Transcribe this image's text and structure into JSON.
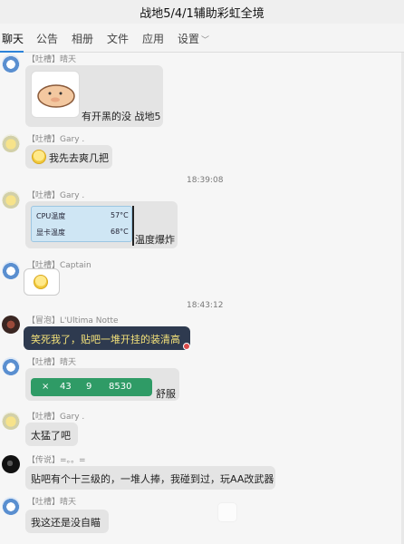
{
  "window": {
    "title": "战地5/4/1辅助彩虹全境"
  },
  "tabs": [
    {
      "label": "聊天"
    },
    {
      "label": "公告"
    },
    {
      "label": "相册"
    },
    {
      "label": "文件"
    },
    {
      "label": "应用"
    },
    {
      "label": "设置"
    }
  ],
  "messages": [
    {
      "sender": "【吐槽】晴天",
      "text": "有开黑的没 战地5"
    },
    {
      "sender": "【吐槽】Gary .",
      "text": "我先去爽几把"
    },
    {
      "time": "18:39:08"
    },
    {
      "sender": "【吐槽】Gary .",
      "text": "温度爆炸",
      "widget": {
        "cpu_label": "CPU温度",
        "cpu_value": "57°C",
        "gpu_label": "显卡温度",
        "gpu_value": "68°C"
      }
    },
    {
      "sender": "【吐槽】Captain",
      "text": ""
    },
    {
      "time": "18:43:12"
    },
    {
      "sender": "【冒泡】L'Ultima Notte",
      "text": "笑死我了，贴吧一堆开挂的装清高"
    },
    {
      "sender": "【吐槽】晴天",
      "text": "舒服",
      "game_bar": {
        "a": "×",
        "b": "43",
        "c": "9",
        "d": "8530"
      }
    },
    {
      "sender": "【吐槽】Gary .",
      "text": "太猛了吧"
    },
    {
      "sender": "【传说】=。。=",
      "text": "贴吧有个十三级的，一堆人捧，我碰到过，玩AA改武器"
    },
    {
      "sender": "【吐槽】晴天",
      "text": "我这还是没自瞄"
    }
  ],
  "colors": {
    "accent": "#2b82d9",
    "dark_bubble": "#2e3a4f",
    "dark_bubble_text": "#f4e27a"
  }
}
